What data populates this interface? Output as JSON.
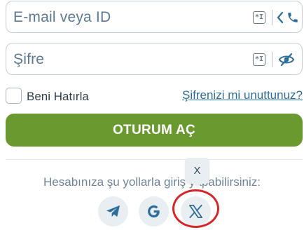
{
  "login_form": {
    "email_placeholder": "E-mail veya ID",
    "password_placeholder": "Şifre",
    "remember_label": "Beni Hatırla",
    "forgot_link": "Şifrenizi mi unuttunuz?",
    "login_button": "OTURUM AÇ",
    "remember_checked": false
  },
  "alternatives": {
    "text": "Hesabınıza şu yollarla giriş yapabilirsiniz:",
    "providers": [
      {
        "name": "Telegram",
        "icon": "telegram-icon"
      },
      {
        "name": "Google",
        "icon": "google-icon"
      },
      {
        "name": "X",
        "icon": "x-icon"
      }
    ],
    "tooltip": "X"
  },
  "colors": {
    "primary_button": "#6a9a2f",
    "link": "#2d6e9a",
    "icon_blue": "#2d6e9a",
    "highlight_circle": "#d6262a"
  },
  "icons": {
    "keyboard": "keyboard-icon",
    "phone": "phone-icon",
    "chevron": "chevron-left-icon",
    "visibility": "eye-slash-icon"
  }
}
